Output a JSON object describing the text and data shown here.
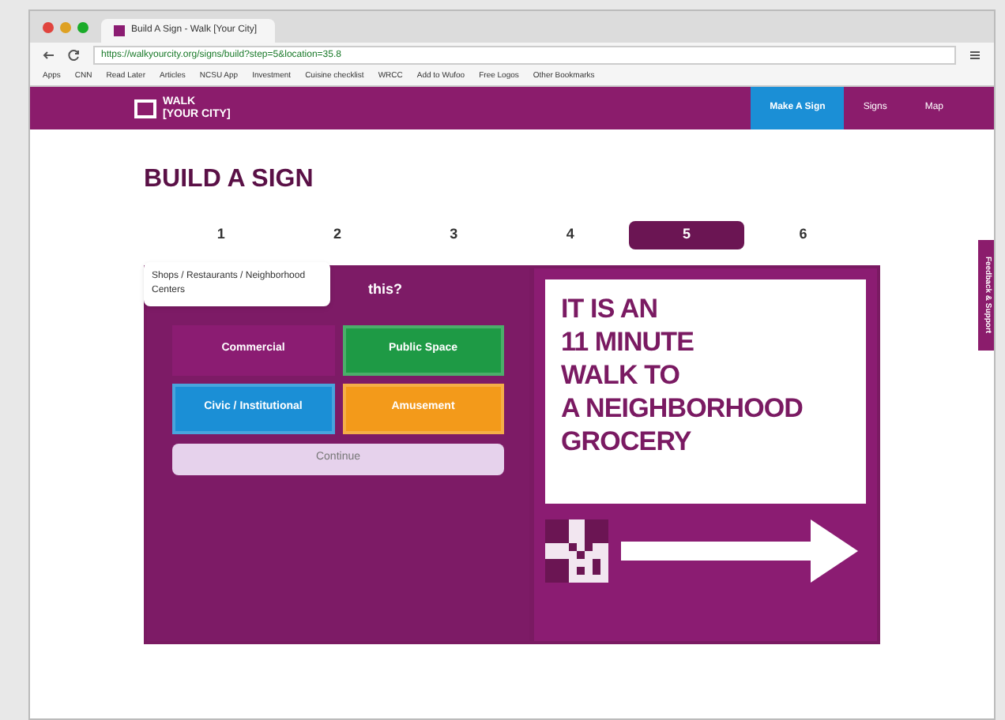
{
  "browser": {
    "tab_title": "Build A Sign - Walk [Your City]",
    "url": "https://walkyourcity.org/signs/build?step=5&location=35.8",
    "bookmarks": [
      "Apps",
      "CNN",
      "Read Later",
      "Articles",
      "NCSU App",
      "Investment",
      "Cuisine checklist",
      "WRCC",
      "Add to Wufoo",
      "Free Logos",
      "Other Bookmarks"
    ]
  },
  "site": {
    "logo_line1": "WALK",
    "logo_line2": "[YOUR CITY]",
    "nav": [
      {
        "label": "Make A Sign",
        "selected": true
      },
      {
        "label": "Signs",
        "selected": false
      },
      {
        "label": "Map",
        "selected": false
      }
    ]
  },
  "page_title": "BUILD A SIGN",
  "steps": [
    {
      "label": "1",
      "selected": false
    },
    {
      "label": "2",
      "selected": false
    },
    {
      "label": "3",
      "selected": false
    },
    {
      "label": "4",
      "selected": false
    },
    {
      "label": "5",
      "selected": true
    },
    {
      "label": "6",
      "selected": false
    }
  ],
  "question": "this?",
  "tooltip": "Shops / Restaurants / Neighborhood Centers",
  "categories": [
    {
      "label": "Commercial",
      "color": "#8b1c72",
      "selected": true
    },
    {
      "label": "Public Space",
      "color": "#1e9a45",
      "selected": false
    },
    {
      "label": "Civic / Institutional",
      "color": "#1b8fd6",
      "selected": false
    },
    {
      "label": "Amusement",
      "color": "#f39a1a",
      "selected": false
    }
  ],
  "continue_button": "Continue",
  "sign": {
    "lines": [
      "IT IS AN",
      "11 MINUTE",
      "WALK TO",
      "A NEIGHBORHOOD",
      "GROCERY"
    ]
  },
  "feedback_tab": "Feedback & Support"
}
